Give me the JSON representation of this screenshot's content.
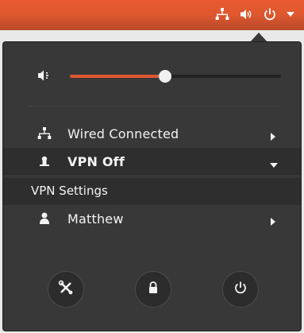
{
  "topbar": {
    "icons": [
      "network-icon",
      "volume-icon",
      "power-icon",
      "dropdown-arrow-icon"
    ]
  },
  "menu": {
    "volume": {
      "level": 0.45,
      "icon": "volume-icon"
    },
    "wired": {
      "label": "Wired Connected",
      "icon": "network-icon"
    },
    "vpn": {
      "label": "VPN Off",
      "icon": "vpn-icon"
    },
    "vpn_settings": {
      "label": "VPN Settings"
    },
    "user": {
      "label": "Matthew",
      "icon": "user-icon"
    },
    "buttons": [
      "settings-icon",
      "lock-icon",
      "power-icon"
    ]
  },
  "colors": {
    "accent": "#e0582e",
    "menu_bg": "#383838",
    "text": "#f3f3f3"
  }
}
